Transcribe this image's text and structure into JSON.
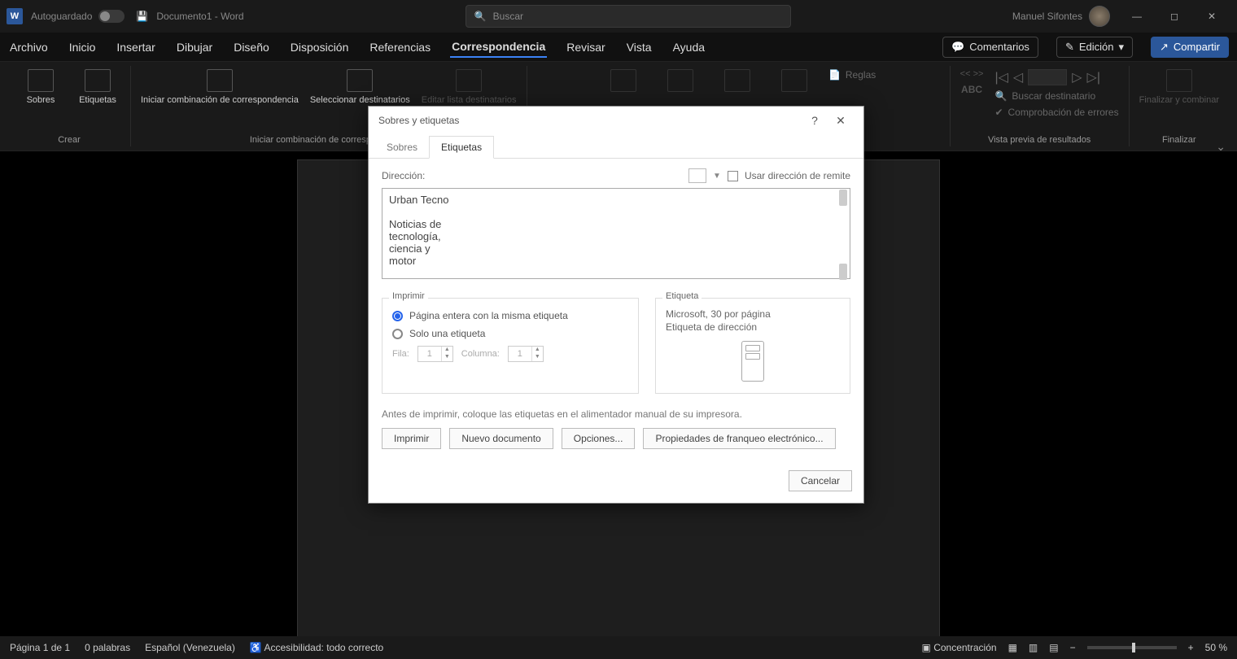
{
  "titlebar": {
    "autosave": "Autoguardado",
    "doc": "Documento1 - Word",
    "search_placeholder": "Buscar",
    "user": "Manuel Sifontes"
  },
  "tabs": {
    "archivo": "Archivo",
    "inicio": "Inicio",
    "insertar": "Insertar",
    "dibujar": "Dibujar",
    "diseno": "Diseño",
    "disposicion": "Disposición",
    "referencias": "Referencias",
    "correspondencia": "Correspondencia",
    "revisar": "Revisar",
    "vista": "Vista",
    "ayuda": "Ayuda",
    "comentarios": "Comentarios",
    "edicion": "Edición",
    "compartir": "Compartir"
  },
  "ribbon": {
    "sobres": "Sobres",
    "etiquetas": "Etiquetas",
    "crear": "Crear",
    "iniciar_comb": "Iniciar combinación de correspondencia",
    "seleccionar": "Seleccionar destinatarios",
    "editar": "Editar lista destinatarios",
    "grp_iniciar": "Iniciar combinación de correspondencia",
    "reglas": "Reglas",
    "abc": "ABC",
    "buscar_dest": "Buscar destinatario",
    "comprobacion": "Comprobación de errores",
    "vista_previa": "Vista previa de resultados",
    "finalizar_comb": "Finalizar y combinar",
    "finalizar": "Finalizar"
  },
  "dialog": {
    "title": "Sobres y etiquetas",
    "tab_sobres": "Sobres",
    "tab_etiquetas": "Etiquetas",
    "direccion": "Dirección:",
    "usar_remite": "Usar dirección de remite",
    "address_text": "Urban Tecno\n\nNoticias de\ntecnología,\nciencia y\nmotor",
    "imprimir_legend": "Imprimir",
    "opt_pagina": "Página entera con la misma etiqueta",
    "opt_solo": "Solo una etiqueta",
    "fila": "Fila:",
    "columna": "Columna:",
    "spin1": "1",
    "spin2": "1",
    "etiqueta_legend": "Etiqueta",
    "et_line1": "Microsoft, 30 por página",
    "et_line2": "Etiqueta de dirección",
    "hint": "Antes de imprimir, coloque las etiquetas en el alimentador manual de su impresora.",
    "btn_imprimir": "Imprimir",
    "btn_nuevo": "Nuevo documento",
    "btn_opciones": "Opciones...",
    "btn_prop": "Propiedades de franqueo electrónico...",
    "btn_cancelar": "Cancelar"
  },
  "status": {
    "page": "Página 1 de 1",
    "words": "0 palabras",
    "lang": "Español (Venezuela)",
    "acc": "Accesibilidad: todo correcto",
    "conc": "Concentración",
    "zoom": "50 %"
  }
}
